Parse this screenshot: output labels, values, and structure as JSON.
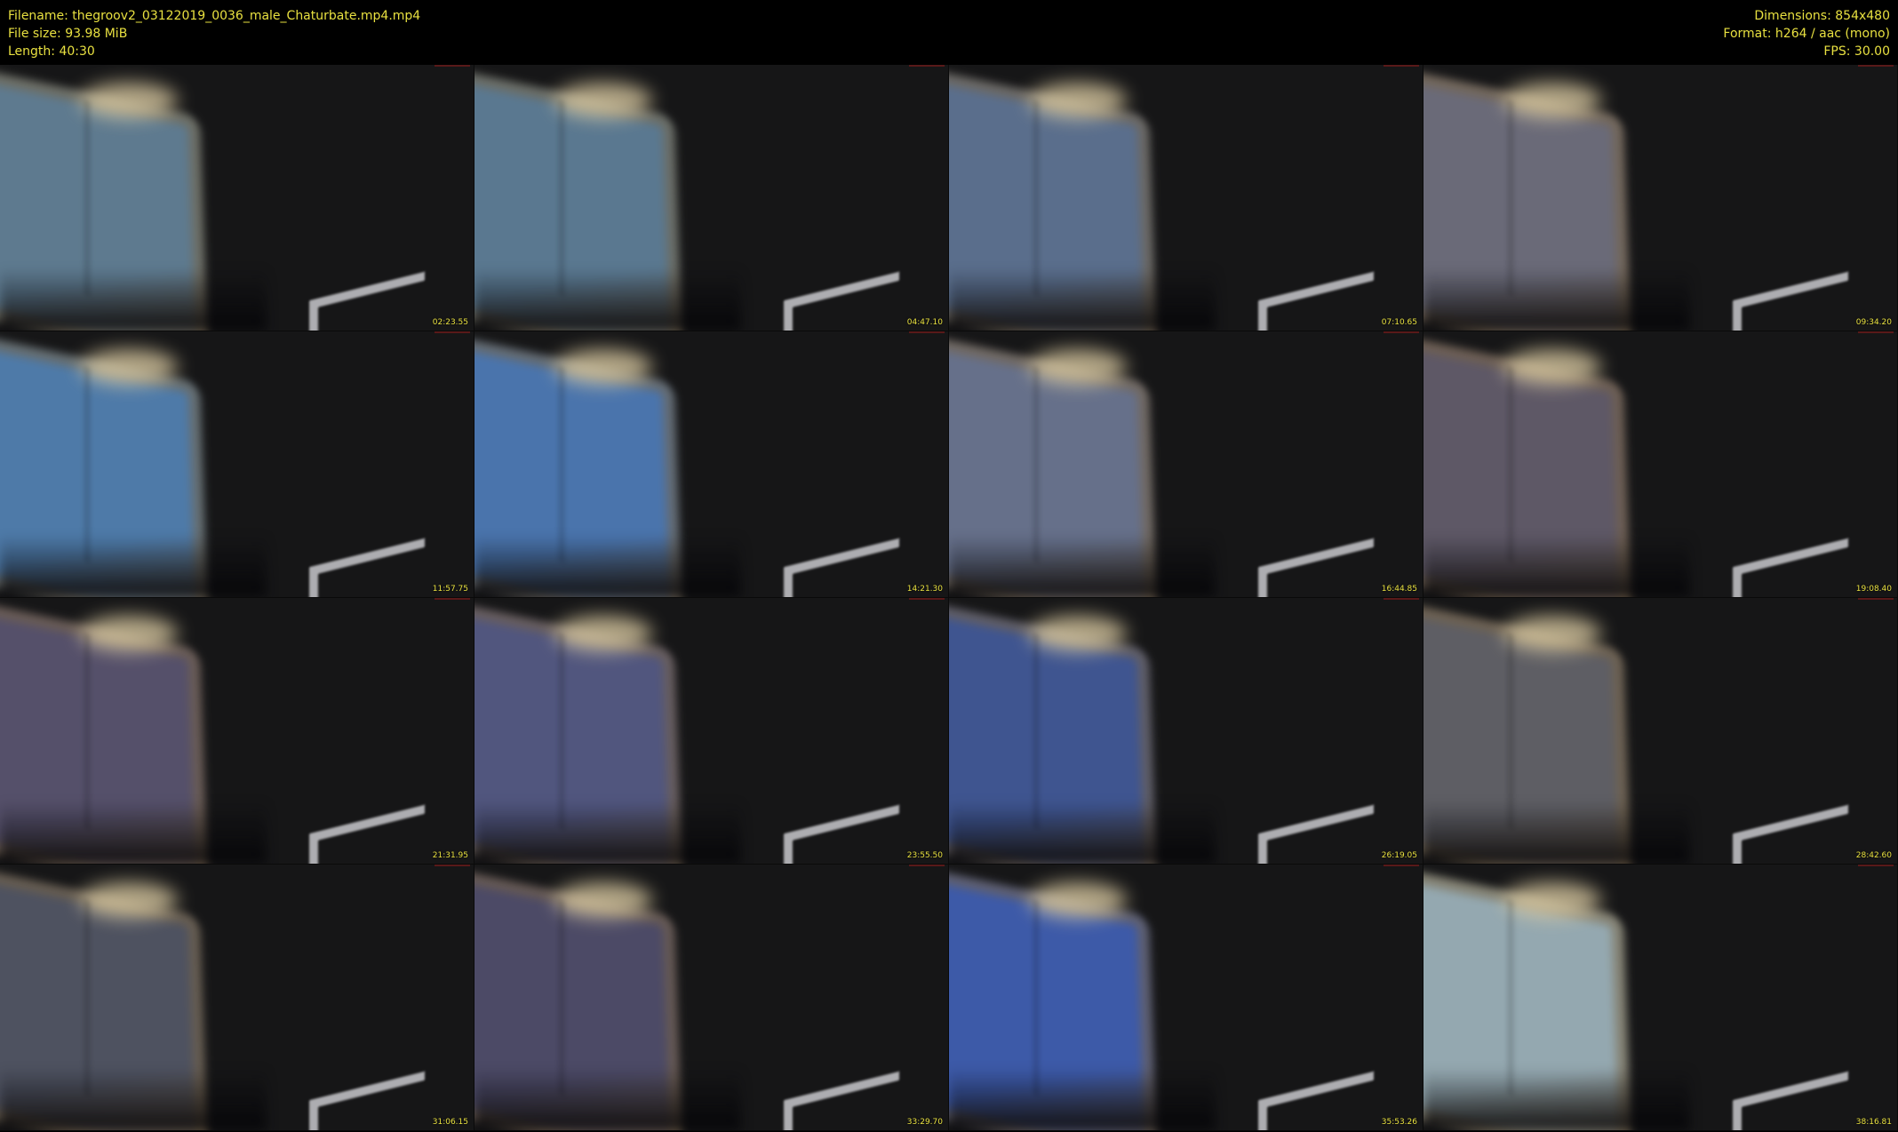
{
  "header": {
    "left": [
      "Filename: thegroov2_03122019_0036_male_Chaturbate.mp4.mp4",
      "File size: 93.98 MiB",
      "Length: 40:30"
    ],
    "right": [
      "Dimensions: 854x480",
      "Format: h264 / aac (mono)",
      "FPS: 30.00"
    ]
  },
  "colors": {
    "text": "#e8e040",
    "background": "#000000"
  },
  "thumbnails": [
    {
      "time": "02:23.55",
      "tint": "#5e7a8f"
    },
    {
      "time": "04:47.10",
      "tint": "#5a7890"
    },
    {
      "time": "07:10.65",
      "tint": "#5a6e8c"
    },
    {
      "time": "09:34.20",
      "tint": "#6a6a78"
    },
    {
      "time": "11:57.75",
      "tint": "#4e7aa8"
    },
    {
      "time": "14:21.30",
      "tint": "#4a74ac"
    },
    {
      "time": "16:44.85",
      "tint": "#66708a"
    },
    {
      "time": "19:08.40",
      "tint": "#5e5866"
    },
    {
      "time": "21:31.95",
      "tint": "#55506a"
    },
    {
      "time": "23:55.50",
      "tint": "#51567e"
    },
    {
      "time": "26:19.05",
      "tint": "#3f5590"
    },
    {
      "time": "28:42.60",
      "tint": "#5e5e64"
    },
    {
      "time": "31:06.15",
      "tint": "#4e5260"
    },
    {
      "time": "33:29.70",
      "tint": "#4c4a66"
    },
    {
      "time": "35:53.26",
      "tint": "#3d5aa8"
    },
    {
      "time": "38:16.81",
      "tint": "#94a8b0"
    }
  ]
}
